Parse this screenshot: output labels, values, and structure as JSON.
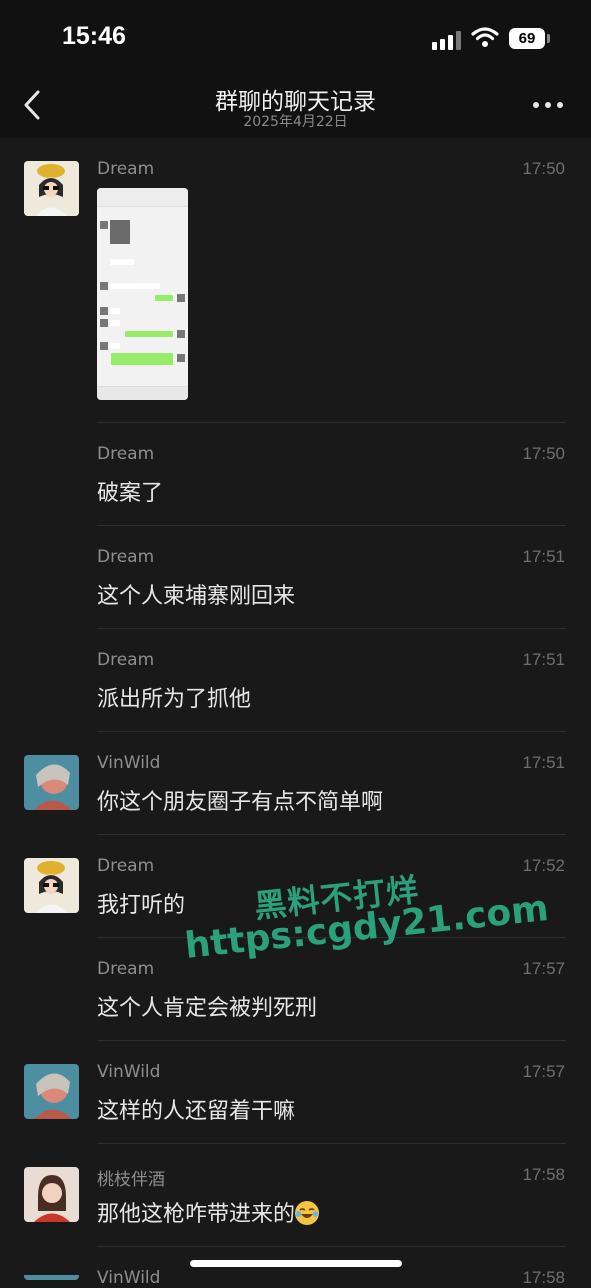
{
  "status": {
    "time": "15:46",
    "battery": "69"
  },
  "header": {
    "title": "群聊的聊天记录",
    "date": "2025年4月22日"
  },
  "messages": [
    {
      "sender": "Dream",
      "time": "17:50",
      "type": "image"
    },
    {
      "sender": "Dream",
      "time": "17:50",
      "text": "破案了"
    },
    {
      "sender": "Dream",
      "time": "17:51",
      "text": "这个人柬埔寨刚回来"
    },
    {
      "sender": "Dream",
      "time": "17:51",
      "text": "派出所为了抓他"
    },
    {
      "sender": "VinWild",
      "time": "17:51",
      "text": "你这个朋友圈子有点不简单啊"
    },
    {
      "sender": "Dream",
      "time": "17:52",
      "text": "我打听的"
    },
    {
      "sender": "Dream",
      "time": "17:57",
      "text": "这个人肯定会被判死刑"
    },
    {
      "sender": "VinWild",
      "time": "17:57",
      "text": "这样的人还留着干嘛"
    },
    {
      "sender": "桃枝伴酒",
      "time": "17:58",
      "text": "那他这枪咋带进来的",
      "emoji": "face-with-tears-of-joy"
    },
    {
      "sender": "VinWild",
      "time": "17:58"
    }
  ],
  "watermark": {
    "line1": "黑料不打烊",
    "line2": "https:cgdy21.com"
  },
  "icons": {
    "back": "back-chevron-icon",
    "more": "more-dots-icon"
  }
}
